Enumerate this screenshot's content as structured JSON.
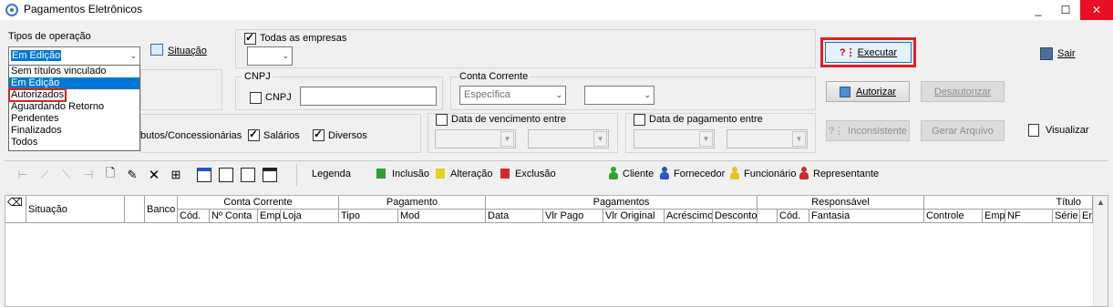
{
  "window": {
    "title": "Pagamentos Eletrônicos",
    "minimize": "_",
    "maximize": "☐",
    "close": "✕"
  },
  "tipos": {
    "label": "Tipos de operação",
    "selected": "Em Edição",
    "options": [
      "Sem títulos vinculado",
      "Em Edição",
      "Autorizados",
      "Aguardando Retorno",
      "Pendentes",
      "Finalizados",
      "Todos"
    ]
  },
  "situacao_label": "Situação",
  "todas_empresas_label": "Todas as empresas",
  "cnpj": {
    "group_label": "CNPJ",
    "check_label": "CNPJ"
  },
  "conta_corrente": {
    "label": "Conta Corrente",
    "selected": "Específica"
  },
  "checks": {
    "tributos_label": "butos/Concessionárias",
    "salarios_label": "Salários",
    "diversos_label": "Diversos"
  },
  "dates": {
    "vencimento_label": "Data de vencimento entre",
    "pagamento_label": "Data de pagamento entre"
  },
  "buttons": {
    "executar": "Executar",
    "sair": "Sair",
    "autorizar": "Autorizar",
    "desautorizar": "Desautorizar",
    "inconsistente": "Inconsistente",
    "gerar_arquivo": "Gerar Arquivo",
    "visualizar": "Visualizar"
  },
  "legend": {
    "title": "Legenda",
    "inclusao": "Inclusão",
    "alteracao": "Alteração",
    "exclusao": "Exclusão",
    "cliente": "Cliente",
    "fornecedor": "Fornecedor",
    "funcionario": "Funcionário",
    "representante": "Representante",
    "colors": {
      "inclusao": "#2e9e2e",
      "alteracao": "#e8d21a",
      "exclusao": "#d8262a",
      "cliente": "#2fa52f",
      "fornecedor": "#2456c6",
      "funcionario": "#e8c21a",
      "representante": "#d8262a"
    }
  },
  "grid": {
    "groups": [
      "Conta Corrente",
      "Pagamento",
      "Pagamentos",
      "Responsável",
      "Título"
    ],
    "situacao": "Situação",
    "banco": "Banco",
    "cols": [
      "Cód.",
      "Nº Conta",
      "Emp",
      "Loja",
      "Tipo",
      "Mod",
      "Data",
      "Vlr Pago",
      "Vlr Original",
      "Acréscimo",
      "Desconto",
      "Cód.",
      "Fantasia",
      "Controle",
      "Emp",
      "NF",
      "Série",
      "En"
    ]
  },
  "accent": "#e0201f"
}
